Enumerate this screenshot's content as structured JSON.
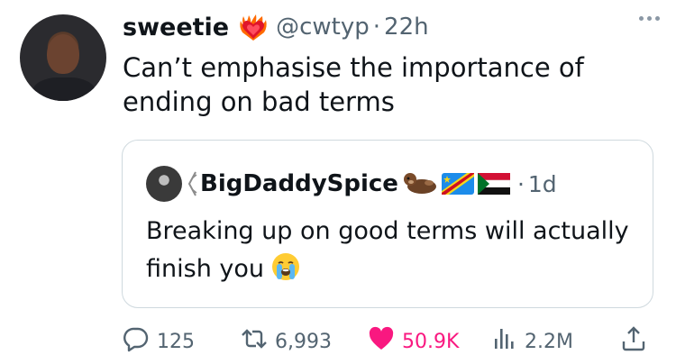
{
  "tweet": {
    "display_name": "sweetie",
    "name_emoji": "heart-on-fire-emoji",
    "handle": "@cwtyp",
    "separator": "·",
    "time": "22h",
    "text": "Can’t emphasise the importance of ending on bad terms"
  },
  "quote": {
    "display_name": "BigDaddySpice",
    "emojis": [
      "otter-emoji",
      "congo-flag",
      "sudan-flag"
    ],
    "separator": "·",
    "time": "1d",
    "text": "Breaking up on good terms will actually finish you",
    "trailing_emoji": "loudly-crying-face-emoji"
  },
  "actions": {
    "replies": "125",
    "reposts": "6,993",
    "likes": "50.9K",
    "views": "2.2M"
  },
  "colors": {
    "text_primary": "#0f1419",
    "text_secondary": "#536471",
    "like": "#f91880",
    "border": "#cfd9de"
  }
}
